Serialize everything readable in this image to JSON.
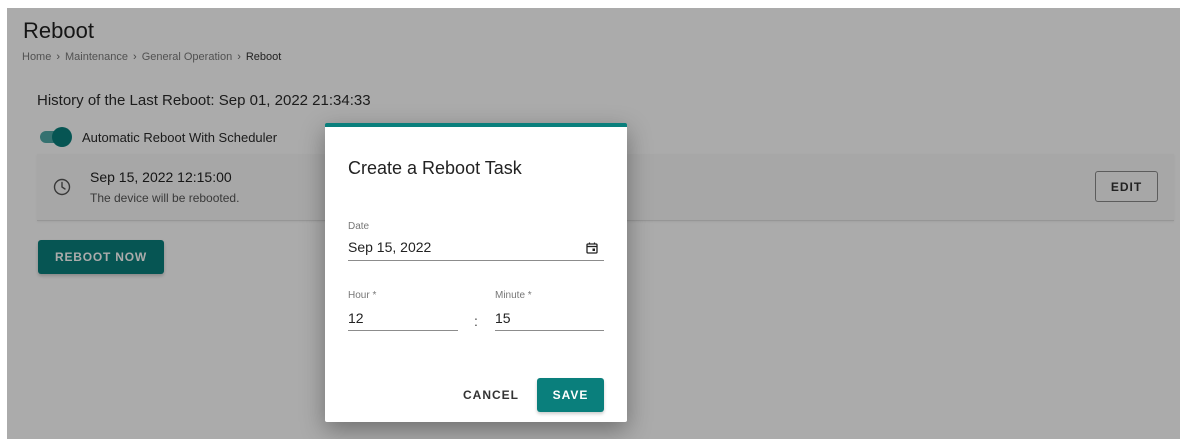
{
  "page": {
    "title": "Reboot",
    "breadcrumb": [
      {
        "label": "Home"
      },
      {
        "label": "Maintenance"
      },
      {
        "label": "General Operation"
      },
      {
        "label": "Reboot"
      }
    ],
    "breadcrumb_separator": "›",
    "history": "History of the Last Reboot: Sep 01, 2022 21:34:33",
    "scheduler": {
      "label": "Automatic Reboot With Scheduler",
      "enabled": true
    },
    "task": {
      "time": "Sep 15, 2022 12:15:00",
      "description": "The device will be rebooted.",
      "icon": "clock-icon",
      "edit_label": "EDIT"
    },
    "reboot_now_label": "REBOOT NOW"
  },
  "dialog": {
    "title": "Create a Reboot Task",
    "date": {
      "label": "Date",
      "value": "Sep 15, 2022",
      "icon": "calendar-icon"
    },
    "hour": {
      "label": "Hour *",
      "value": "12"
    },
    "separator": ":",
    "minute": {
      "label": "Minute *",
      "value": "15"
    },
    "cancel_label": "CANCEL",
    "save_label": "SAVE"
  },
  "colors": {
    "accent": "#0a7f7c",
    "accent_light": "#4fa9a7",
    "overlay": "rgba(0,0,0,0.33)"
  }
}
